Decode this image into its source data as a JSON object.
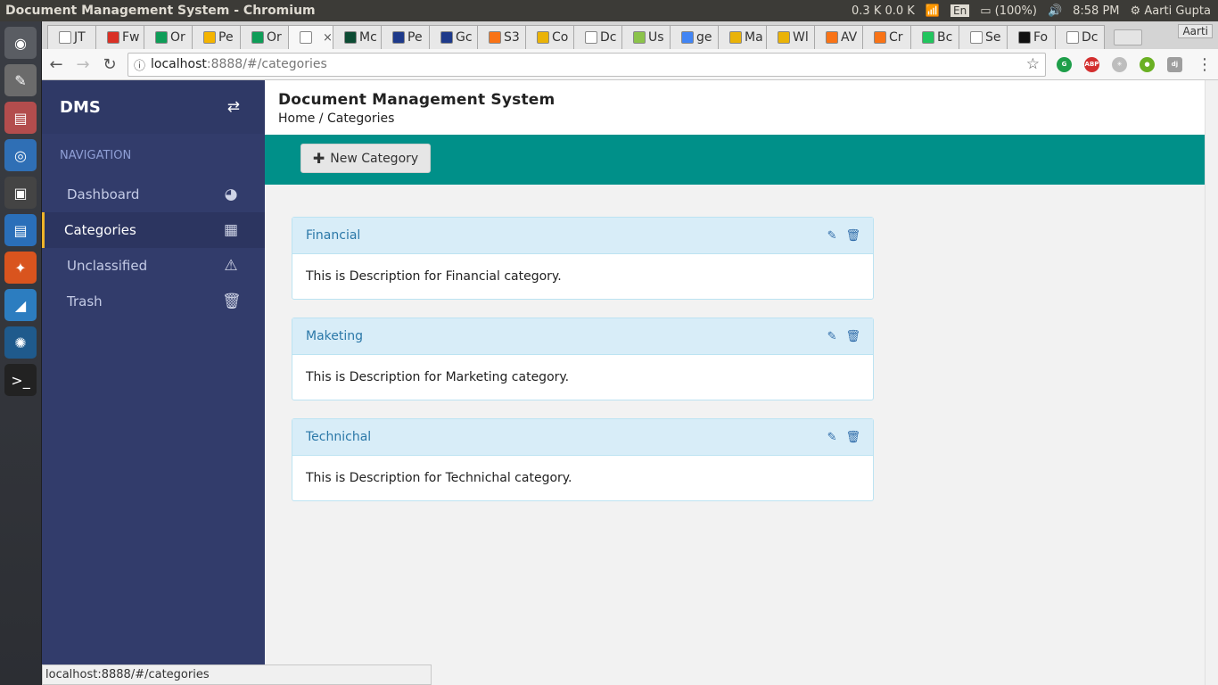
{
  "window_title": "Document Management System - Chromium",
  "indicators": {
    "network": "0.3 K 0.0 K",
    "lang": "En",
    "battery": "(100%)",
    "time": "8:58 PM",
    "user": "Aarti Gupta"
  },
  "tabs": [
    {
      "label": "JT",
      "color": "#ffffff"
    },
    {
      "label": "Fw",
      "color": "#d93025"
    },
    {
      "label": "Or",
      "color": "#0f9d58"
    },
    {
      "label": "Pe",
      "color": "#f4b400"
    },
    {
      "label": "Or",
      "color": "#0f9d58"
    },
    {
      "label": "",
      "color": "#ffffff",
      "active": true
    },
    {
      "label": "Mc",
      "color": "#0c4b33"
    },
    {
      "label": "Pe",
      "color": "#1e3a8a"
    },
    {
      "label": "Gc",
      "color": "#1e3a8a"
    },
    {
      "label": "S3",
      "color": "#f97316"
    },
    {
      "label": "Co",
      "color": "#eab308"
    },
    {
      "label": "Dc",
      "color": "#ffffff"
    },
    {
      "label": "Us",
      "color": "#8bc34a"
    },
    {
      "label": "ge",
      "color": "#4285f4"
    },
    {
      "label": "Ma",
      "color": "#eab308"
    },
    {
      "label": "Wl",
      "color": "#eab308"
    },
    {
      "label": "AV",
      "color": "#f97316"
    },
    {
      "label": "Cr",
      "color": "#f97316"
    },
    {
      "label": "Bc",
      "color": "#22c55e"
    },
    {
      "label": "Se",
      "color": "#ffffff"
    },
    {
      "label": "Fo",
      "color": "#111111"
    },
    {
      "label": "Dc",
      "color": "#ffffff"
    }
  ],
  "profile_label": "Aarti",
  "address": {
    "host": "localhost",
    "rest": ":8888/#/categories"
  },
  "sidebar": {
    "brand": "DMS",
    "nav_heading": "NAVIGATION",
    "items": [
      {
        "label": "Dashboard",
        "icon": "dashboard-icon",
        "glyph": "◕",
        "active": false
      },
      {
        "label": "Categories",
        "icon": "grid-icon",
        "glyph": "▦",
        "active": true
      },
      {
        "label": "Unclassified",
        "icon": "warning-icon",
        "glyph": "⚠",
        "active": false
      },
      {
        "label": "Trash",
        "icon": "trash-icon",
        "glyph": "🗑",
        "active": false
      }
    ]
  },
  "page": {
    "title": "Document Management System",
    "breadcrumb": "Home / Categories"
  },
  "actions": {
    "new_category": "New Category"
  },
  "categories": [
    {
      "name": "Financial",
      "description": "This is Description for Financial category."
    },
    {
      "name": "Maketing",
      "description": "This is Description for Marketing category."
    },
    {
      "name": "Technichal",
      "description": "This is Description for Technichal category."
    }
  ],
  "status_url": "localhost:8888/#/categories",
  "colors": {
    "sidebar": "#323c6b",
    "accent": "#009089",
    "active_marker": "#f0b429",
    "card_header": "#d8edf8"
  }
}
